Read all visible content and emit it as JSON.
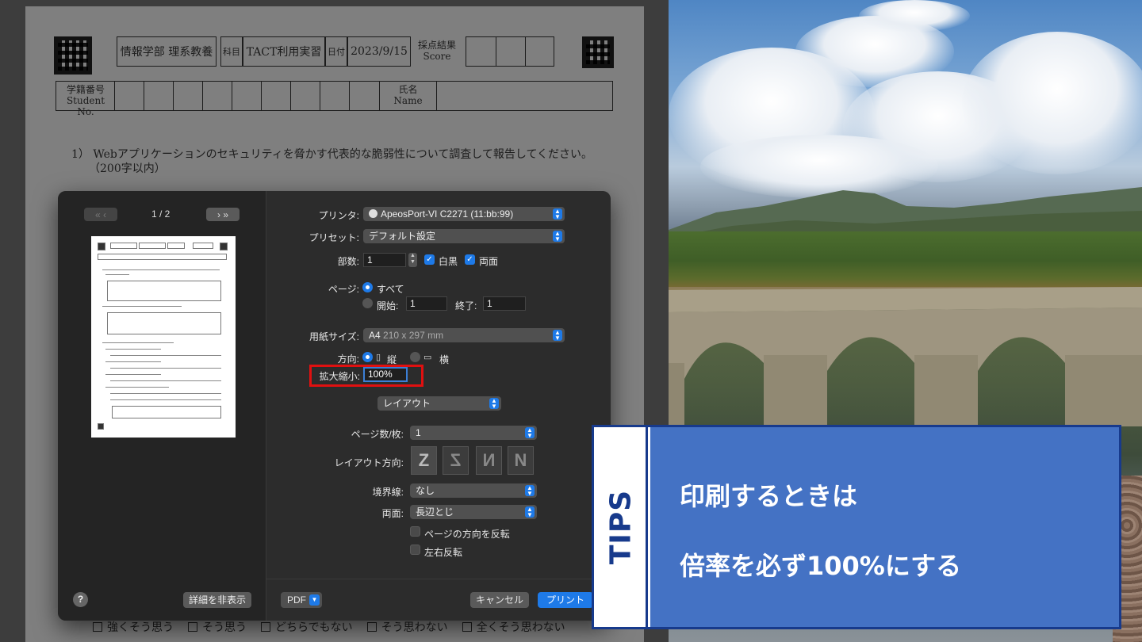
{
  "document": {
    "header": {
      "department": "情報学部 理系教養",
      "subject_label": "科目",
      "subject": "TACT利用実習",
      "date_label": "日付",
      "date": "2023/9/15",
      "score_label": "採点結果",
      "score_label_en": "Score",
      "student_no_label": "学籍番号",
      "student_no_label_en": "Student No.",
      "name_label": "氏名",
      "name_label_en": "Name"
    },
    "question1": "1） Webアプリケーションのセキュリティを脅かす代表的な脆弱性について調査して報告してください。",
    "question1_limit": "（200字以内）",
    "bottom_options": [
      "強くそう思う",
      "そう思う",
      "どちらでもない",
      "そう思わない",
      "全くそう思わない"
    ]
  },
  "print_dialog": {
    "preview": {
      "prev_label": "«  ‹",
      "next_label": "›  »",
      "page_counter": "1 / 2"
    },
    "printer_label": "プリンタ:",
    "printer_value": "ApeosPort-VI C2271 (11:bb:99)",
    "preset_label": "プリセット:",
    "preset_value": "デフォルト設定",
    "copies_label": "部数:",
    "copies_value": "1",
    "bw_label": "白黒",
    "bw_checked": true,
    "duplex_label": "両面",
    "duplex_checked": true,
    "pages_label": "ページ:",
    "pages_all_label": "すべて",
    "pages_from_label": "開始:",
    "pages_from_value": "1",
    "pages_to_label": "終了:",
    "pages_to_value": "1",
    "paper_size_label": "用紙サイズ:",
    "paper_size_value": "A4",
    "paper_size_detail": "210 x 297 mm",
    "orientation_label": "方向:",
    "orientation_portrait": "縦",
    "orientation_landscape": "横",
    "scale_label": "拡大縮小:",
    "scale_value": "100%",
    "section_select": "レイアウト",
    "pages_per_sheet_label": "ページ数/枚:",
    "pages_per_sheet_value": "1",
    "layout_direction_label": "レイアウト方向:",
    "border_label": "境界線:",
    "border_value": "なし",
    "two_sided_label": "両面:",
    "two_sided_value": "長辺とじ",
    "reverse_orientation_label": "ページの方向を反転",
    "flip_horizontal_label": "左右反転",
    "help_label": "?",
    "hide_details_label": "詳細を非表示",
    "pdf_label": "PDF",
    "cancel_label": "キャンセル",
    "print_label": "プリント"
  },
  "tips": {
    "label": "TIPS",
    "line1": "印刷するときは",
    "line2": "倍率を必ず100%にする"
  },
  "colors": {
    "highlight": "#e01010",
    "accent": "#1e7ae8",
    "tips_blue": "#4472c4",
    "tips_border": "#173a8c"
  }
}
